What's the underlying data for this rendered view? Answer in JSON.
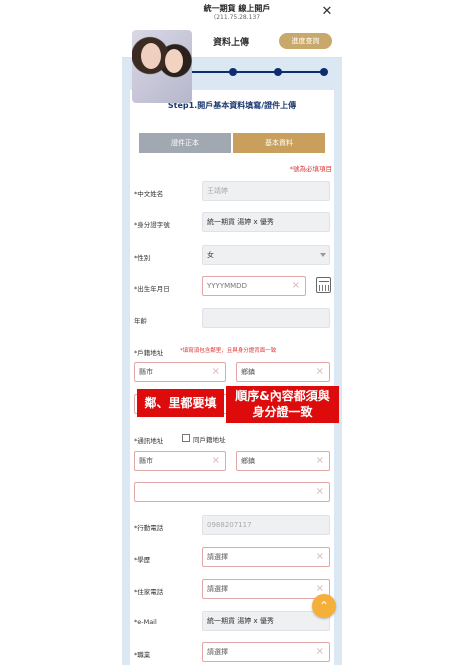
{
  "topbar": {
    "title": "統一期貨 線上開戶",
    "ip": "(211.75.28.137",
    "close": "✕"
  },
  "header": {
    "title": "資料上傳",
    "progress_button": "進度查詢"
  },
  "step": {
    "title": "Step1.開戶基本資料填寫/證件上傳"
  },
  "tabs": [
    {
      "label": "證件正本"
    },
    {
      "label": "基本資料"
    }
  ],
  "required_note": "*號為必填項目",
  "fields": {
    "name": {
      "label": "*中文姓名",
      "value": "王靖婷"
    },
    "id": {
      "label": "*身分證字號",
      "value": "統一期貨 湯婷 x 優秀"
    },
    "gender": {
      "label": "*性別",
      "value": "女"
    },
    "birthday": {
      "label": "*出生年月日",
      "placeholder": "YYYYMMDD"
    },
    "age": {
      "label": "年齡",
      "value": ""
    },
    "household": {
      "label": "*戶籍地址",
      "note": "*填寫須包含鄰里，且與身分證背面一致",
      "county": "縣市",
      "district": "鄉鎮"
    },
    "mailing": {
      "label": "*通訊地址",
      "same_label": "同戶籍地址",
      "county": "縣市",
      "district": "鄉鎮"
    },
    "mobile": {
      "label": "*行動電話",
      "value": "0988207117"
    },
    "education": {
      "label": "*學歷",
      "value": "請選擇"
    },
    "home_phone": {
      "label": "*住家電話",
      "value": "請選擇"
    },
    "email": {
      "label": "*e-Mail",
      "value": "統一期貨 湯婷 x 優秀"
    },
    "job": {
      "label": "*職業",
      "value": "請選擇"
    }
  },
  "callouts": {
    "left": "鄰、里都要填",
    "right_line1": "順序&內容都須與",
    "right_line2": "身分證一致"
  },
  "float_button": "⌃"
}
